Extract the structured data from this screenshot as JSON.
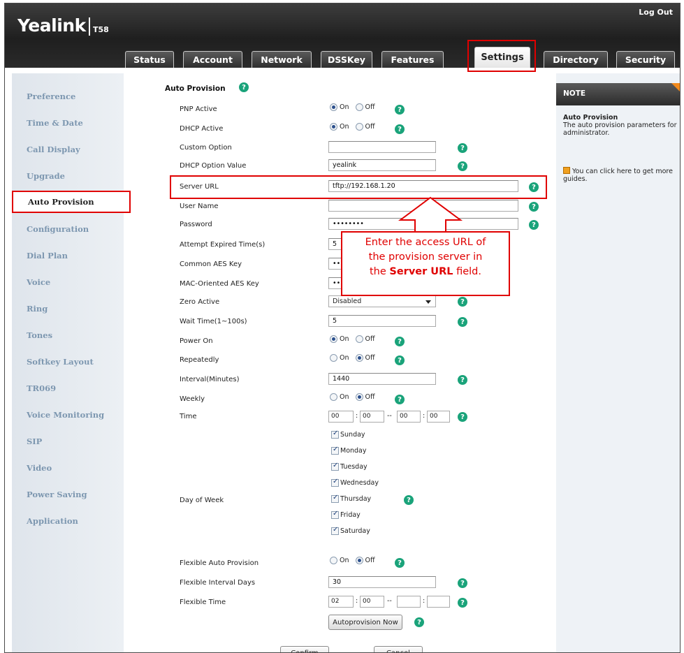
{
  "header": {
    "logo": "Yealink",
    "model": "T58",
    "logout": "Log Out"
  },
  "tabs": [
    {
      "label": "Status"
    },
    {
      "label": "Account"
    },
    {
      "label": "Network"
    },
    {
      "label": "DSSKey"
    },
    {
      "label": "Features"
    },
    {
      "label": "Settings"
    },
    {
      "label": "Directory"
    },
    {
      "label": "Security"
    }
  ],
  "active_tab": "Settings",
  "sidebar": {
    "items": [
      {
        "label": "Preference"
      },
      {
        "label": "Time & Date"
      },
      {
        "label": "Call Display"
      },
      {
        "label": "Upgrade"
      },
      {
        "label": "Auto Provision"
      },
      {
        "label": "Configuration"
      },
      {
        "label": "Dial Plan"
      },
      {
        "label": "Voice"
      },
      {
        "label": "Ring"
      },
      {
        "label": "Tones"
      },
      {
        "label": "Softkey Layout"
      },
      {
        "label": "TR069"
      },
      {
        "label": "Voice Monitoring"
      },
      {
        "label": "SIP"
      },
      {
        "label": "Video"
      },
      {
        "label": "Power Saving"
      },
      {
        "label": "Application"
      }
    ],
    "active": "Auto Provision"
  },
  "form": {
    "section_title": "Auto Provision",
    "radio_on": "On",
    "radio_off": "Off",
    "pnp_active": {
      "label": "PNP Active",
      "value": "On"
    },
    "dhcp_active": {
      "label": "DHCP Active",
      "value": "On"
    },
    "custom_option": {
      "label": "Custom Option",
      "value": ""
    },
    "dhcp_option_value": {
      "label": "DHCP Option Value",
      "value": "yealink"
    },
    "server_url": {
      "label": "Server URL",
      "value": "tftp://192.168.1.20"
    },
    "user_name": {
      "label": "User Name",
      "value": ""
    },
    "password": {
      "label": "Password",
      "value": "••••••••"
    },
    "attempt_expired": {
      "label": "Attempt Expired Time(s)",
      "value": "5"
    },
    "common_aes": {
      "label": "Common AES Key",
      "value": "••"
    },
    "mac_aes": {
      "label": "MAC-Oriented AES Key",
      "value": "••"
    },
    "zero_active": {
      "label": "Zero Active",
      "value": "Disabled"
    },
    "wait_time": {
      "label": "Wait Time(1~100s)",
      "value": "5"
    },
    "power_on": {
      "label": "Power On",
      "value": "On"
    },
    "repeatedly": {
      "label": "Repeatedly",
      "value": "Off"
    },
    "interval": {
      "label": "Interval(Minutes)",
      "value": "1440"
    },
    "weekly": {
      "label": "Weekly",
      "value": "Off"
    },
    "time": {
      "label": "Time",
      "h1": "00",
      "m1": "00",
      "h2": "00",
      "m2": "00"
    },
    "day_of_week": {
      "label": "Day of Week",
      "days": [
        "Sunday",
        "Monday",
        "Tuesday",
        "Wednesday",
        "Thursday",
        "Friday",
        "Saturday"
      ]
    },
    "flex_auto": {
      "label": "Flexible Auto Provision",
      "value": "Off"
    },
    "flex_days": {
      "label": "Flexible Interval Days",
      "value": "30"
    },
    "flex_time": {
      "label": "Flexible Time",
      "h1": "02",
      "m1": "00",
      "h2": "",
      "m2": ""
    },
    "autoprovision_now": "Autoprovision Now",
    "confirm": "Confirm",
    "cancel": "Cancel"
  },
  "callout": {
    "line1": "Enter the access URL of",
    "line2": "the provision  server in",
    "line3_pre": "the ",
    "line3_bold": "Server URL",
    "line3_post": " field."
  },
  "note": {
    "head": "NOTE",
    "title": "Auto Provision",
    "text": "The auto provision parameters for administrator.",
    "guide": "You can click here to get more guides."
  },
  "colors": {
    "highlight": "#e00000",
    "help": "#1aa37a",
    "nav": "#7d97b0"
  }
}
